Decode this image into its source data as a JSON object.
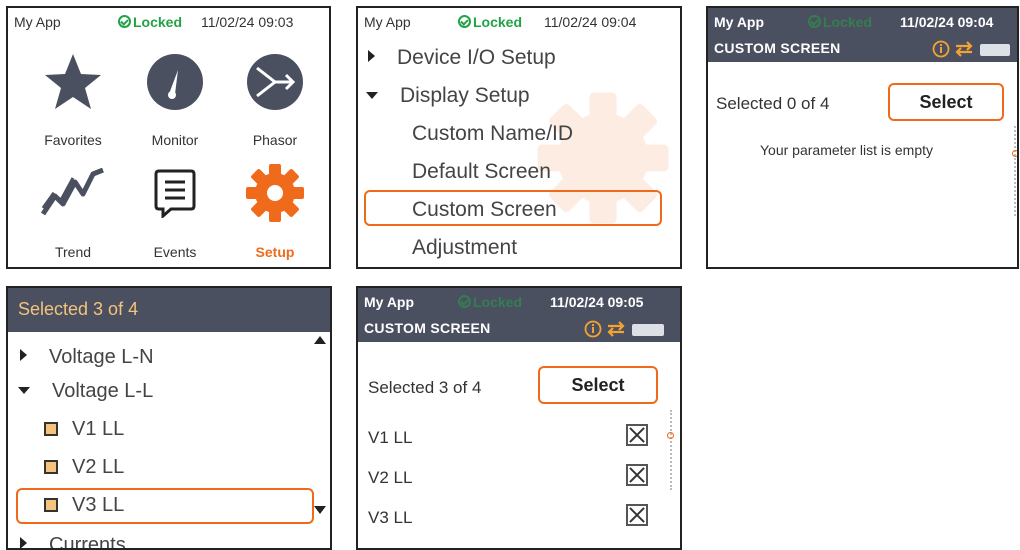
{
  "colors": {
    "accent": "#ef6b1b",
    "locked_green": "#23a245",
    "header_dark": "#4b5060",
    "selection_text": "#f4c37c"
  },
  "panel1": {
    "app": "My App",
    "lock": "Locked",
    "time": "11/02/24 09:03",
    "tiles": [
      {
        "label": "Favorites",
        "icon": "star-icon"
      },
      {
        "label": "Monitor",
        "icon": "gauge-icon"
      },
      {
        "label": "Phasor",
        "icon": "phasor-icon"
      },
      {
        "label": "Trend",
        "icon": "trend-icon"
      },
      {
        "label": "Events",
        "icon": "events-icon"
      },
      {
        "label": "Setup",
        "icon": "gear-icon"
      }
    ]
  },
  "panel2": {
    "app": "My App",
    "lock": "Locked",
    "time": "11/02/24 09:04",
    "items": [
      "Device I/O Setup",
      "Display Setup",
      "Custom Name/ID",
      "Default Screen",
      "Custom Screen",
      "Adjustment"
    ]
  },
  "panel3": {
    "app": "My App",
    "lock": "Locked",
    "time": "11/02/24 09:04",
    "title": "CUSTOM SCREEN",
    "selected": "Selected 0 of 4",
    "select": "Select",
    "empty": "Your parameter list is empty"
  },
  "panel4": {
    "header": "Selected 3 of 4",
    "items": [
      "Voltage L-N",
      "Voltage L-L",
      "V1 LL",
      "V2 LL",
      "V3 LL",
      "Currents"
    ]
  },
  "panel5": {
    "app": "My App",
    "lock": "Locked",
    "time": "11/02/24 09:05",
    "title": "CUSTOM SCREEN",
    "selected": "Selected 3 of 4",
    "select": "Select",
    "params": [
      "V1 LL",
      "V2 LL",
      "V3 LL"
    ]
  }
}
